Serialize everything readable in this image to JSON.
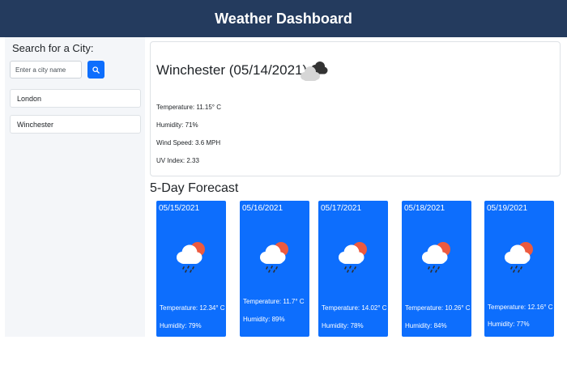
{
  "header": {
    "title": "Weather Dashboard"
  },
  "sidebar": {
    "title": "Search for a City:",
    "search_placeholder": "Enter a city name",
    "search_icon": "search-icon",
    "history": [
      "London",
      "Winchester"
    ]
  },
  "current": {
    "title": "Winchester (05/14/2021)",
    "icon": "cloudy-icon",
    "temperature": "Temperature: 11.15° C",
    "humidity": "Humidity: 71%",
    "wind": "Wind Speed: 3.6 MPH",
    "uv": "UV Index: 2.33"
  },
  "forecast": {
    "title": "5-Day Forecast",
    "days": [
      {
        "date": "05/15/2021",
        "icon": "rain-sun-icon",
        "temperature": "Temperature: 12.34° C",
        "humidity": "Humidity: 79%"
      },
      {
        "date": "05/16/2021",
        "icon": "rain-sun-icon",
        "temperature": "Temperature: 11.7° C",
        "humidity": "Humidity: 89%"
      },
      {
        "date": "05/17/2021",
        "icon": "rain-sun-icon",
        "temperature": "Temperature: 14.02° C",
        "humidity": "Humidity: 78%"
      },
      {
        "date": "05/18/2021",
        "icon": "rain-sun-icon",
        "temperature": "Temperature: 10.26° C",
        "humidity": "Humidity: 84%"
      },
      {
        "date": "05/19/2021",
        "icon": "rain-sun-icon",
        "temperature": "Temperature: 12.16° C",
        "humidity": "Humidity: 77%"
      }
    ]
  },
  "colors": {
    "header": "#243b5e",
    "accent": "#0d6efd",
    "sidebar": "#f4f6f9"
  }
}
